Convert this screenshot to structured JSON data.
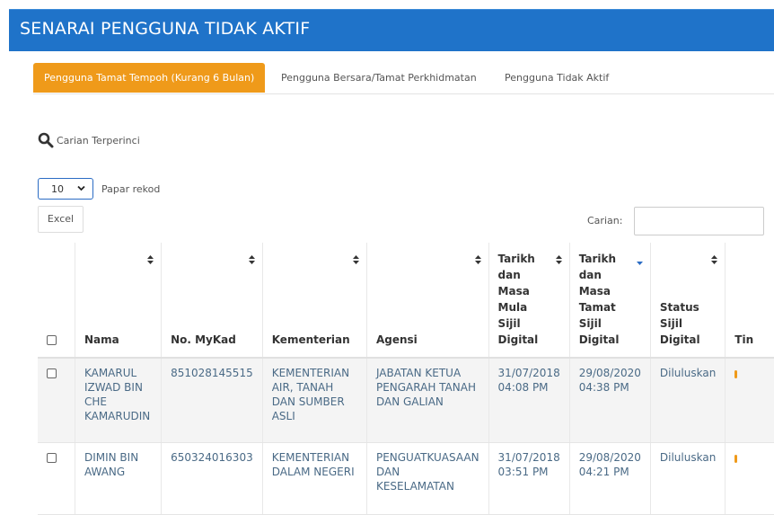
{
  "header": {
    "title": "SENARAI PENGGUNA TIDAK AKTIF"
  },
  "tabs": [
    {
      "label": "Pengguna Tamat Tempoh (Kurang 6 Bulan)",
      "active": true
    },
    {
      "label": "Pengguna Bersara/Tamat Perkhidmatan",
      "active": false
    },
    {
      "label": "Pengguna Tidak Aktif",
      "active": false
    }
  ],
  "search": {
    "link_label": "Carian Terperinci",
    "label": "Carian:"
  },
  "paging": {
    "selected": "10",
    "label": "Papar rekod"
  },
  "toolbar": {
    "excel_label": "Excel"
  },
  "table": {
    "headers": {
      "nama": "Nama",
      "mykad": "No. MyKad",
      "kementerian": "Kementerian",
      "agensi": "Agensi",
      "mula": "Tarikh dan Masa Mula Sijil Digital",
      "tamat": "Tarikh dan Masa Tamat Sijil Digital",
      "status": "Status Sijil Digital",
      "tindakan": "Tin"
    },
    "rows": [
      {
        "nama": "KAMARUL IZWAD BIN CHE KAMARUDIN",
        "mykad": "851028145515",
        "kementerian": "KEMENTERIAN AIR, TANAH DAN SUMBER ASLI",
        "agensi": "JABATAN KETUA PENGARAH TANAH DAN GALIAN",
        "mula": "31/07/2018 04:08 PM",
        "tamat": "29/08/2020 04:38 PM",
        "status": "Diluluskan"
      },
      {
        "nama": "DIMIN BIN AWANG",
        "mykad": "650324016303",
        "kementerian": "KEMENTERIAN DALAM NEGERI",
        "agensi": "PENGUATKUASAAN DAN KESELAMATAN",
        "mula": "31/07/2018 03:51 PM",
        "tamat": "29/08/2020 04:21 PM",
        "status": "Diluluskan"
      }
    ]
  },
  "colors": {
    "header_bg": "#1f73c9",
    "active_tab": "#ef9a1a",
    "row_text": "#4a6a86"
  }
}
